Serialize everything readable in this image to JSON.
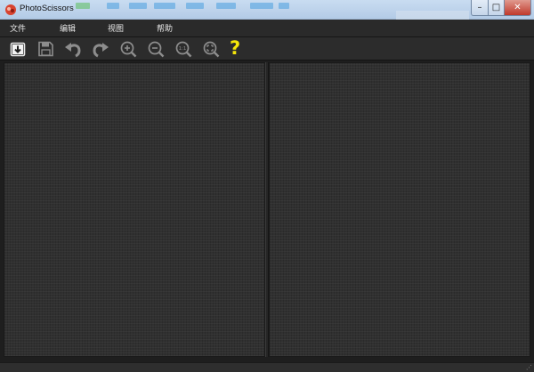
{
  "window": {
    "title": "PhotoScissors",
    "minimize_glyph": "–",
    "maximize_glyph": "□",
    "close_glyph": "✕"
  },
  "menu": {
    "items": [
      {
        "label": "文件"
      },
      {
        "label": "编辑"
      },
      {
        "label": "视图"
      },
      {
        "label": "帮助"
      }
    ]
  },
  "toolbar": {
    "tools": [
      {
        "icon": "open-icon"
      },
      {
        "icon": "save-icon"
      },
      {
        "icon": "undo-icon"
      },
      {
        "icon": "redo-icon"
      },
      {
        "icon": "zoom-in-icon"
      },
      {
        "icon": "zoom-out-icon"
      },
      {
        "icon": "zoom-actual-size-icon",
        "label": "1:1"
      },
      {
        "icon": "zoom-fit-icon"
      },
      {
        "icon": "help-icon",
        "label": "?"
      }
    ]
  },
  "statusbar": {
    "grip_glyph": "⋰"
  },
  "colors": {
    "menubar": "#2a2a2a",
    "canvas": "#303030",
    "help_accent": "#f5e60a",
    "close_button": "#c0392b"
  }
}
